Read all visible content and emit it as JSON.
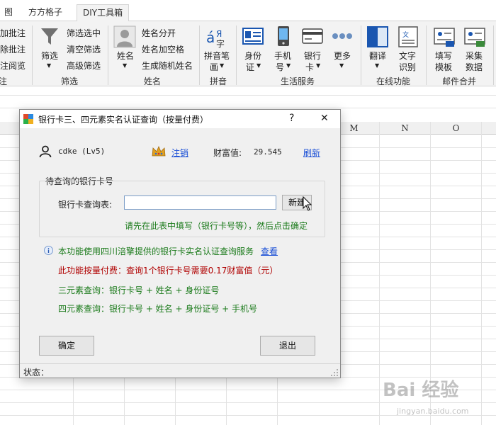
{
  "ribbon": {
    "tabs": [
      "图",
      "方方格子",
      "DIY工具箱"
    ],
    "active_tab_index": 2,
    "comment_items": [
      "加批注",
      "除批注",
      "注阅览"
    ],
    "filter_big": "筛选",
    "filter_items": [
      "筛选选中",
      "清空筛选",
      "高级筛选"
    ],
    "filter_group": "筛选",
    "name_big": "姓名",
    "name_items": [
      "姓名分开",
      "姓名加空格",
      "生成随机姓名"
    ],
    "name_group": "姓名",
    "pinyin_big": [
      "拼音笔",
      "画"
    ],
    "pinyin_group": "拼音",
    "life_buttons": [
      {
        "line1": "身份",
        "line2": "证"
      },
      {
        "line1": "手机",
        "line2": "号"
      },
      {
        "line1": "银行",
        "line2": "卡"
      },
      {
        "line1": "更多",
        "line2": ""
      }
    ],
    "life_group": "生活服务",
    "online_buttons": [
      {
        "line1": "翻译",
        "line2": ""
      },
      {
        "line1": "文字",
        "line2": "识别"
      }
    ],
    "online_group": "在线功能",
    "mail_buttons": [
      {
        "line1": "填写",
        "line2": "模板"
      },
      {
        "line1": "采集",
        "line2": "数据"
      }
    ],
    "mail_group": "邮件合并",
    "left_group_partial": "注"
  },
  "sheet": {
    "columns": [
      "M",
      "N",
      "O"
    ]
  },
  "dialog": {
    "title": "银行卡三、四元素实名认证查询（按量付费）",
    "help_symbol": "?",
    "close_symbol": "✕",
    "user": "cdke (Lv5)",
    "logout": "注销",
    "wealth_label": "财富值:",
    "wealth_value": "29.545",
    "refresh": "刷新",
    "group_title": "待查询的银行卡号",
    "query_label": "银行卡查询表:",
    "query_value": "",
    "new_button": "新建",
    "hint": "请先在此表中填写（银行卡号等），然后点击确定",
    "info_text": "本功能使用四川涪擎提供的银行卡实名认证查询服务",
    "info_link": "查看",
    "price_text": "此功能按量付费：查询1个银行卡号需要0.17财富值（元）",
    "three_elem": "三元素查询：银行卡号 + 姓名 + 身份证号",
    "four_elem": "四元素查询：银行卡号 + 姓名 + 身份证号 + 手机号",
    "ok_button": "确定",
    "exit_button": "退出",
    "status_label": "状态："
  },
  "watermark": {
    "brand": "Bai 经验",
    "url": "jingyan.baidu.com"
  },
  "colors": {
    "link": "#1a4fd6",
    "green": "#1a7a1a",
    "red": "#b00000",
    "crown": "#e0a020"
  }
}
